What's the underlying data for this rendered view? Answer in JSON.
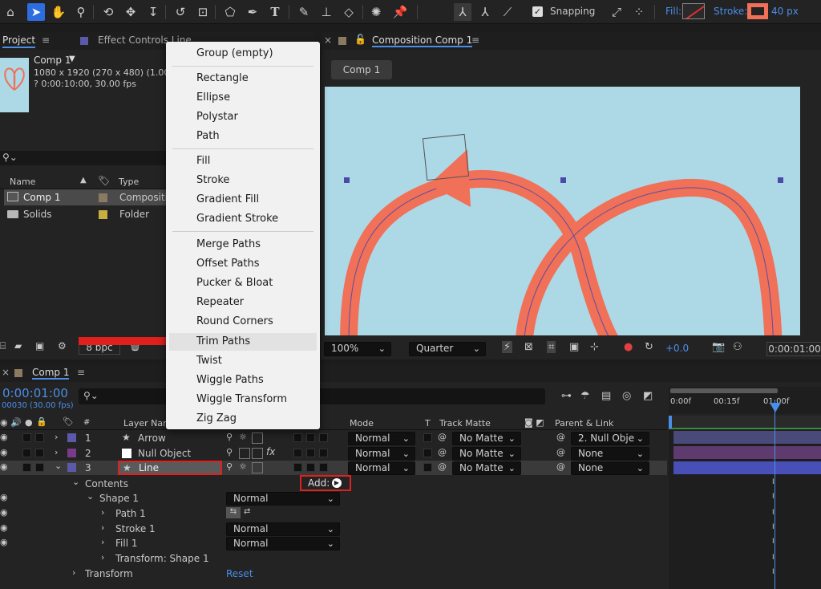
{
  "toolbar": {
    "snapping_label": "Snapping",
    "fill_label": "Fill:",
    "stroke_label": "Stroke:",
    "stroke_width": "40 px",
    "stroke_color": "#f07058"
  },
  "project": {
    "tab_label": "Project",
    "effect_tab_label": "Effect Controls Line",
    "comp_name": "Comp 1",
    "comp_info_1": "1080 x 1920  (270 x 480) (1.00)",
    "comp_info_2": "? 0:00:10:00, 30.00 fps",
    "col_name": "Name",
    "col_type": "Type",
    "items": [
      {
        "name": "Comp 1",
        "type": "Compositio"
      },
      {
        "name": "Solids",
        "type": "Folder"
      }
    ],
    "bpc": "8 bpc"
  },
  "composition": {
    "tab_label": "Composition Comp 1",
    "crumb": "Comp 1",
    "zoom": "100%",
    "resolution": "Quarter",
    "exposure": "+0.0",
    "timecode": "0:00:01:00",
    "bg_color": "#add8e6"
  },
  "menu": {
    "items": [
      "Group (empty)",
      "Rectangle",
      "Ellipse",
      "Polystar",
      "Path",
      "Fill",
      "Stroke",
      "Gradient Fill",
      "Gradient Stroke",
      "Merge Paths",
      "Offset Paths",
      "Pucker & Bloat",
      "Repeater",
      "Round Corners",
      "Trim Paths",
      "Twist",
      "Wiggle Paths",
      "Wiggle Transform",
      "Zig Zag"
    ],
    "highlighted": "Trim Paths"
  },
  "timeline": {
    "tab_label": "Comp 1",
    "timecode": "0:00:01:00",
    "fps_info": "00030 (30.00 fps)",
    "col_layer_name": "Layer Name",
    "col_mode": "Mode",
    "col_t": "T",
    "col_track_matte": "Track Matte",
    "col_parent": "Parent & Link",
    "ruler": [
      "0:00f",
      "00:15f",
      "01:00f"
    ],
    "layers": [
      {
        "num": "1",
        "name": "Arrow",
        "mode": "Normal",
        "matte": "No Matte",
        "parent": "2. Null Obje",
        "color": "#5a5aa8"
      },
      {
        "num": "2",
        "name": "Null Object",
        "mode": "Normal",
        "matte": "No Matte",
        "parent": "None",
        "color": "#7a3a8a"
      },
      {
        "num": "3",
        "name": "Line",
        "mode": "Normal",
        "matte": "No Matte",
        "parent": "None",
        "color": "#5a5aa8"
      }
    ],
    "contents_label": "Contents",
    "add_label": "Add:",
    "shape_label": "Shape 1",
    "shape_mode": "Normal",
    "path_label": "Path 1",
    "stroke_label": "Stroke 1",
    "stroke_mode": "Normal",
    "fill_label": "Fill 1",
    "fill_mode": "Normal",
    "transform_shape_label": "Transform: Shape 1",
    "transform_label": "Transform",
    "reset_label": "Reset"
  }
}
